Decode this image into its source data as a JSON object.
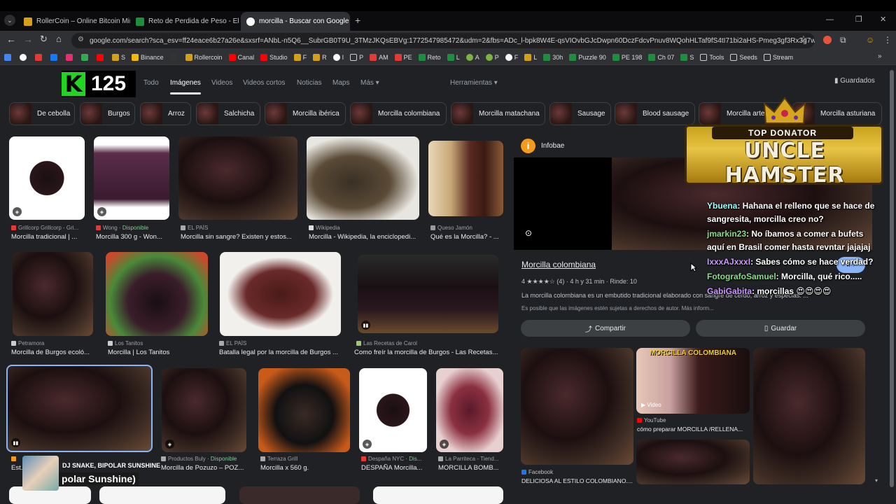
{
  "tabs": [
    {
      "title": "RollerCoin – Online Bitcoin Min",
      "color": "#d4a017"
    },
    {
      "title": "Reto de Perdida de Peso - El M",
      "color": "#1e8e3e"
    },
    {
      "title": "morcilla - Buscar con Google",
      "color": "#4285f4"
    }
  ],
  "url": "google.com/search?sca_esv=ff24eace6b27a26e&sxsrf=ANbL-n5Q6__SubrGB0T9U_3TMzJKQsEBVg:1772547985472&udm=2&fbs=ADc_l-bpk8W4E-qsVIOvbGJcDwpn60DczFdcvPnuv8WQohHLTaf9fS4tI71bi2aHS-Pmeg3gf3Rx3g7wPLd9q85u5EuZ...",
  "bookmarks": [
    "",
    "",
    "",
    "",
    "",
    "",
    "",
    "S",
    "Binance",
    "",
    "Rollercoin",
    "Canal",
    "Studio",
    "F",
    "R",
    "I",
    "P",
    "AM",
    "PE",
    "Reto",
    "L",
    "A",
    "P",
    "F",
    "L",
    "30h",
    "Puzzle 90",
    "PE 198",
    "Ch 07",
    "S",
    "Tools",
    "Seeds",
    "Stream"
  ],
  "overlay": {
    "k_letter": "K",
    "count": "125"
  },
  "google_tabs": [
    "Todo",
    "Imágenes",
    "Videos",
    "Videos cortos",
    "Noticias",
    "Maps",
    "Más ▾"
  ],
  "herramientas": "Herramientas ▾",
  "guardados": "Guardados",
  "chips": [
    "De cebolla",
    "Burgos",
    "Arroz",
    "Salchicha",
    "Morcilla ibérica",
    "Morcilla colombiana",
    "Morcilla matachana",
    "Sausage",
    "Blood sausage",
    "Morcilla artesanal",
    "Morcilla asturiana"
  ],
  "results": [
    {
      "source": "Grillcorp Grillcorp - Gri...",
      "title": "Morcilla tradicional | ...",
      "color": "#e53935"
    },
    {
      "source": "Wong",
      "avail": "· Disponible",
      "title": "Morcilla 300 g - Won...",
      "color": "#e53935"
    },
    {
      "source": "EL PAÍS",
      "title": "Morcilla sin sangre? Existen y estos...",
      "color": "#aaa"
    },
    {
      "source": "Wikipedia",
      "title": "Morcilla - Wikipedia, la enciclopedi...",
      "color": "#ddd"
    },
    {
      "source": "Queso Jamón",
      "title": "Qué es la Morcilla? - ...",
      "color": "#999"
    },
    {
      "source": "Petramora",
      "title": "Morcilla de Burgos ecoló...",
      "color": "#ccc"
    },
    {
      "source": "Los Tanitos",
      "title": "Morcilla | Los Tanitos",
      "color": "#ccc"
    },
    {
      "source": "EL PAÍS",
      "title": "Batalla legal por la morcilla de Burgos ...",
      "color": "#aaa"
    },
    {
      "source": "Las Recetas de Carol",
      "title": "Como freír la morcilla de Burgos - Las Recetas...",
      "color": "#9c6"
    },
    {
      "source": "Productos Buly",
      "avail": "· Disponible",
      "title": "Morcilla de Pozuzo – POZ...",
      "color": "#aaa"
    },
    {
      "source": "Terraza Grill",
      "title": "Morcilla x 560 g.",
      "color": "#aaa"
    },
    {
      "source": "Despaña NYC",
      "avail": "· Dis...",
      "title": "DESPAÑA Morcilla...",
      "color": "#e53935"
    },
    {
      "source": "La Parriteca - Tiend...",
      "title": "MORCILLA BOMB...",
      "color": "#aaa"
    },
    {
      "source": "",
      "title": "Est...",
      "color": "#f29b1d"
    }
  ],
  "panel": {
    "source": "Infobae",
    "title": "Morcilla colombiana",
    "rating": "4 ★★★★☆ (4)  ·  4 h y 31 min  ·  Rinde: 10",
    "desc": "La morcilla colombiana es un embutido tradicional elaborado con sangre de cerdo, arroz y especias. ...",
    "copyright": "Es posible que las imágenes estén sujetas a derechos de autor. Más inform...",
    "go": "Ir ›",
    "share": "Compartir",
    "save": "Guardar",
    "related": [
      {
        "source": "Facebook",
        "title": "DELICIOSA AL ESTILO COLOMBIANO...."
      },
      {
        "source": "YouTube",
        "title": "cómo preparar MORCILLA /RELLENA...",
        "video": "▶ Video",
        "banner": "MORCILLA COLOMBIANA"
      }
    ]
  },
  "chat": [
    {
      "user": "Ybuena",
      "msg": ": Hahana el relleno que se hace de sangresita, morcilla creo no?"
    },
    {
      "user": "jmarkin23",
      "msg": ": No íbamos a comer a bufets aquí en Brasil comer hasta revntar jajajaj"
    },
    {
      "user": "IxxxAJxxxI",
      "msg": ": Sabes cómo se hace verdad?"
    },
    {
      "user": "FotografoSamuel",
      "msg": ": Morcilla, qué rico....."
    },
    {
      "user": "GabiGabita",
      "msg": ": morcillas 😍😍😍😍"
    }
  ],
  "donator": {
    "label": "TOP DONATOR",
    "name": "UNCLE HAMSTER"
  },
  "music": {
    "artist": "DJ SNAKE, BIPOLAR SUNSHINE",
    "song": "polar Sunshine)"
  }
}
